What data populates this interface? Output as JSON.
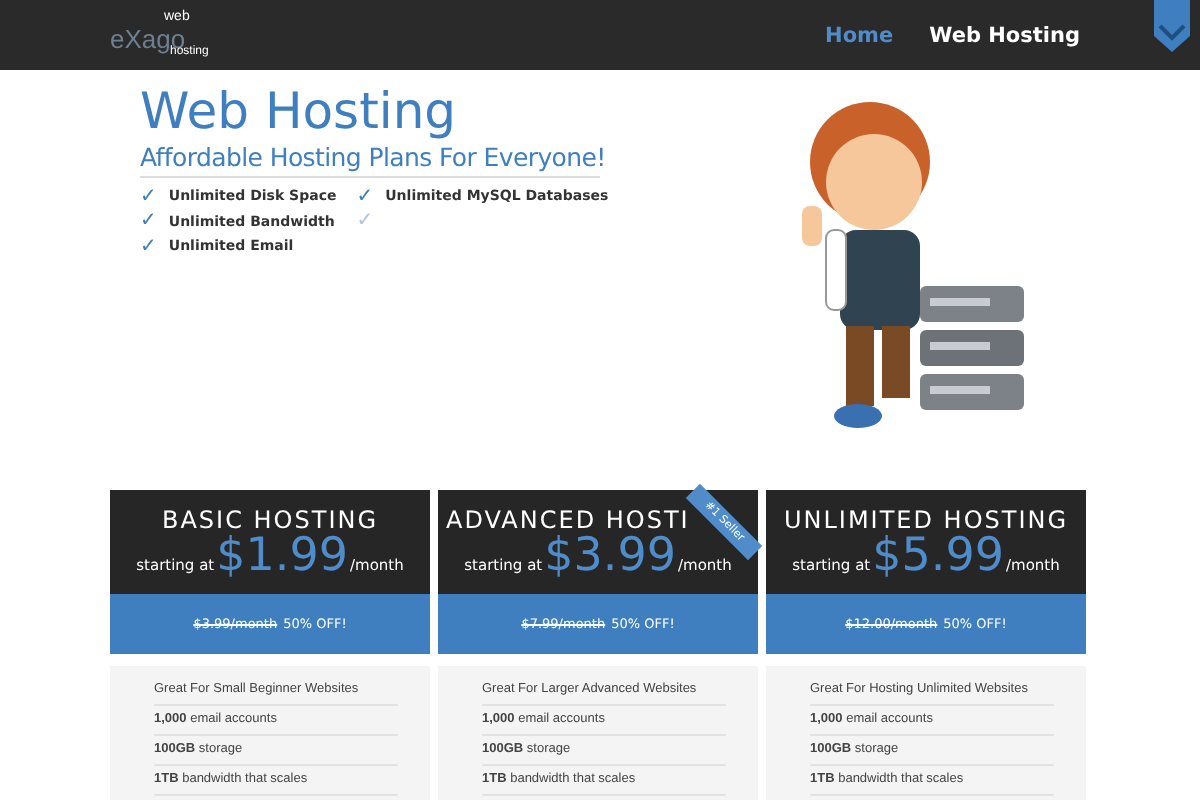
{
  "logo": {
    "word_top": "web",
    "word_main": "eXago",
    "word_bottom": "hosting"
  },
  "nav": [
    {
      "label": "Home",
      "selected": true
    },
    {
      "label": "Web Hosting",
      "selected": false
    }
  ],
  "hero": {
    "title": "Web Hosting",
    "subtitle": "Affordable Hosting Plans For Everyone!",
    "features": [
      {
        "check": "✓",
        "label": "Unlimited Disk Space"
      },
      {
        "check": "✓",
        "label": "Unlimited Bandwidth"
      },
      {
        "check": "✓",
        "label": "Unlimited Email"
      },
      {
        "check": "✓",
        "label": "Unlimited MySQL Databases"
      },
      {
        "check": "✓"
      }
    ]
  },
  "plans": [
    {
      "name": "BASIC HOSTING",
      "prefix": "starting at",
      "price": "$1.99",
      "period": "/month",
      "old_price": "$3.99/month",
      "discount": "50% OFF!",
      "features": [
        "Great For Small Beginner Websites",
        "**1,000** email accounts",
        "**100GB** storage",
        "**1TB** bandwidth that scales"
      ]
    },
    {
      "name": "ADVANCED HOSTI",
      "ribbon": "#1 Seller",
      "prefix": "starting at",
      "price": "$3.99",
      "period": "/month",
      "old_price": "$7.99/month",
      "discount": "50% OFF!",
      "features": [
        "Great For Larger Advanced Websites",
        "**1,000** email accounts",
        "**100GB** storage",
        "**1TB** bandwidth that scales"
      ]
    },
    {
      "name": "UNLIMITED HOSTING",
      "prefix": "starting at",
      "price": "$5.99",
      "period": "/month",
      "old_price": "$12.00/month",
      "discount": "50% OFF!",
      "features": [
        "Great For Hosting Unlimited Websites",
        "**1,000** email accounts",
        "**100GB** storage",
        "**1TB** bandwidth that scales"
      ]
    }
  ]
}
